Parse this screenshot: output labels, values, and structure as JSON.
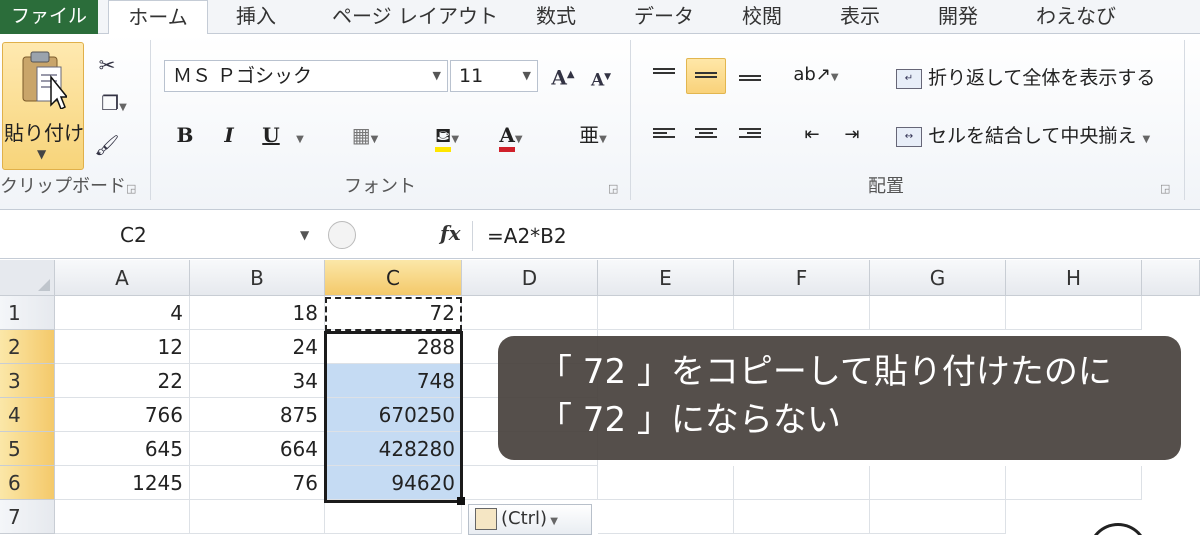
{
  "tabs": {
    "file": "ファイル",
    "home": "ホーム",
    "insert": "挿入",
    "page_layout": "ページ レイアウト",
    "formulas": "数式",
    "data": "データ",
    "review": "校閲",
    "view": "表示",
    "developer": "開発",
    "wae": "わえなび"
  },
  "clipboard": {
    "paste_label": "貼り付け",
    "group_label": "クリップボード"
  },
  "font": {
    "name": "ＭＳ Ｐゴシック",
    "size": "11",
    "grow": "A",
    "shrink": "A",
    "bold": "B",
    "italic": "I",
    "underline": "U",
    "group_label": "フォント"
  },
  "alignment": {
    "wrap_text": "折り返して全体を表示する",
    "merge_center": "セルを結合して中央揃え",
    "group_label": "配置"
  },
  "formula_bar": {
    "name_box": "C2",
    "fx": "fx",
    "formula": "=A2*B2"
  },
  "columns": [
    "A",
    "B",
    "C",
    "D",
    "E",
    "F",
    "G",
    "H"
  ],
  "rows": [
    {
      "num": "1",
      "a": "4",
      "b": "18",
      "c": "72"
    },
    {
      "num": "2",
      "a": "12",
      "b": "24",
      "c": "288"
    },
    {
      "num": "3",
      "a": "22",
      "b": "34",
      "c": "748"
    },
    {
      "num": "4",
      "a": "766",
      "b": "875",
      "c": "670250"
    },
    {
      "num": "5",
      "a": "645",
      "b": "664",
      "c": "428280"
    },
    {
      "num": "6",
      "a": "1245",
      "b": "76",
      "c": "94620"
    },
    {
      "num": "7",
      "a": "",
      "b": "",
      "c": ""
    }
  ],
  "paste_options": "(Ctrl)",
  "overlay": {
    "line1": "「 72 」をコピーして貼り付けたのに",
    "line2": "「 72 」にならない"
  },
  "colors": {
    "file_tab": "#2b6d3a",
    "selection_fill": "#c5dbf3",
    "header_highlight": "#f4c96a",
    "overlay_bg": "#46403c"
  }
}
